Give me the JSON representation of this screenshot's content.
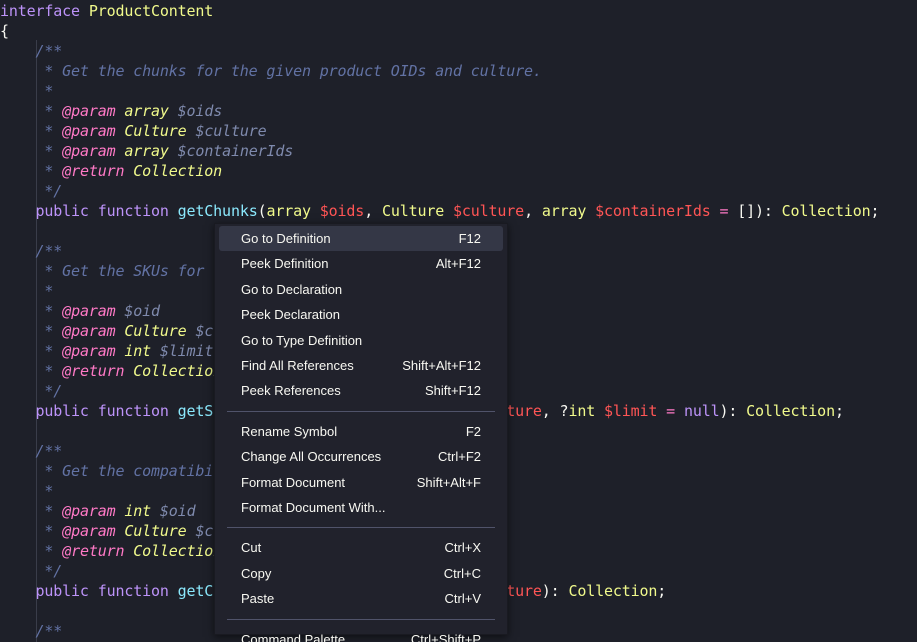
{
  "code": {
    "lines": [
      [
        [
          "kw2",
          "interface"
        ],
        [
          "plain",
          " "
        ],
        [
          "type",
          "ProductContent"
        ]
      ],
      [
        [
          "plain",
          "{"
        ]
      ],
      [
        [
          "plain",
          "    "
        ],
        [
          "comment",
          "/**"
        ]
      ],
      [
        [
          "plain",
          "    "
        ],
        [
          "comment",
          " * Get the chunks for the given product OIDs and culture."
        ]
      ],
      [
        [
          "plain",
          "    "
        ],
        [
          "comment",
          " *"
        ]
      ],
      [
        [
          "plain",
          "    "
        ],
        [
          "comment",
          " * "
        ],
        [
          "tag",
          "@param"
        ],
        [
          "comment",
          " "
        ],
        [
          "ctype",
          "array"
        ],
        [
          "comment",
          " "
        ],
        [
          "cvar",
          "$oids"
        ]
      ],
      [
        [
          "plain",
          "    "
        ],
        [
          "comment",
          " * "
        ],
        [
          "tag",
          "@param"
        ],
        [
          "comment",
          " "
        ],
        [
          "ctype",
          "Culture"
        ],
        [
          "comment",
          " "
        ],
        [
          "cvar",
          "$culture"
        ]
      ],
      [
        [
          "plain",
          "    "
        ],
        [
          "comment",
          " * "
        ],
        [
          "tag",
          "@param"
        ],
        [
          "comment",
          " "
        ],
        [
          "ctype",
          "array"
        ],
        [
          "comment",
          " "
        ],
        [
          "cvar",
          "$containerIds"
        ]
      ],
      [
        [
          "plain",
          "    "
        ],
        [
          "comment",
          " * "
        ],
        [
          "tag",
          "@return"
        ],
        [
          "comment",
          " "
        ],
        [
          "ctype",
          "Collection"
        ]
      ],
      [
        [
          "plain",
          "    "
        ],
        [
          "comment",
          " */"
        ]
      ],
      [
        [
          "plain",
          "    "
        ],
        [
          "kw2",
          "public"
        ],
        [
          "plain",
          " "
        ],
        [
          "kw2",
          "function"
        ],
        [
          "plain",
          " "
        ],
        [
          "fn2",
          "getChunks"
        ],
        [
          "punc",
          "("
        ],
        [
          "type",
          "array"
        ],
        [
          "plain",
          " "
        ],
        [
          "var2",
          "$oids"
        ],
        [
          "punc",
          ", "
        ],
        [
          "type",
          "Culture"
        ],
        [
          "plain",
          " "
        ],
        [
          "var2",
          "$culture"
        ],
        [
          "punc",
          ", "
        ],
        [
          "type",
          "array"
        ],
        [
          "plain",
          " "
        ],
        [
          "var2",
          "$containerIds"
        ],
        [
          "plain",
          " "
        ],
        [
          "op",
          "="
        ],
        [
          "plain",
          " "
        ],
        [
          "punc",
          "[]): "
        ],
        [
          "type",
          "Collection"
        ],
        [
          "punc",
          ";"
        ]
      ],
      [],
      [
        [
          "plain",
          "    "
        ],
        [
          "comment",
          "/**"
        ]
      ],
      [
        [
          "plain",
          "    "
        ],
        [
          "comment",
          " * Get the SKUs for"
        ]
      ],
      [
        [
          "plain",
          "    "
        ],
        [
          "comment",
          " *"
        ]
      ],
      [
        [
          "plain",
          "    "
        ],
        [
          "comment",
          " * "
        ],
        [
          "tag",
          "@param"
        ],
        [
          "comment",
          " "
        ],
        [
          "cvar",
          "$oid"
        ]
      ],
      [
        [
          "plain",
          "    "
        ],
        [
          "comment",
          " * "
        ],
        [
          "tag",
          "@param"
        ],
        [
          "comment",
          " "
        ],
        [
          "ctype",
          "Culture"
        ],
        [
          "comment",
          " "
        ],
        [
          "cvar",
          "$c"
        ]
      ],
      [
        [
          "plain",
          "    "
        ],
        [
          "comment",
          " * "
        ],
        [
          "tag",
          "@param"
        ],
        [
          "comment",
          " "
        ],
        [
          "ctype",
          "int"
        ],
        [
          "comment",
          " "
        ],
        [
          "cvar",
          "$limit"
        ]
      ],
      [
        [
          "plain",
          "    "
        ],
        [
          "comment",
          " * "
        ],
        [
          "tag",
          "@return"
        ],
        [
          "comment",
          " "
        ],
        [
          "ctype",
          "Collection"
        ]
      ],
      [
        [
          "plain",
          "    "
        ],
        [
          "comment",
          " */"
        ]
      ],
      [
        [
          "plain",
          "    "
        ],
        [
          "kw2",
          "public"
        ],
        [
          "plain",
          " "
        ],
        [
          "kw2",
          "function"
        ],
        [
          "plain",
          " "
        ],
        [
          "fn2",
          "getS"
        ],
        [
          "plain",
          "                             "
        ],
        [
          "var2",
          "$culture"
        ],
        [
          "punc",
          ", ?"
        ],
        [
          "type",
          "int"
        ],
        [
          "plain",
          " "
        ],
        [
          "var2",
          "$limit"
        ],
        [
          "plain",
          " "
        ],
        [
          "op",
          "="
        ],
        [
          "plain",
          " "
        ],
        [
          "kw2",
          "null"
        ],
        [
          "punc",
          "): "
        ],
        [
          "type",
          "Collection"
        ],
        [
          "punc",
          ";"
        ]
      ],
      [],
      [
        [
          "plain",
          "    "
        ],
        [
          "comment",
          "/**"
        ]
      ],
      [
        [
          "plain",
          "    "
        ],
        [
          "comment",
          " * Get the compatibi"
        ]
      ],
      [
        [
          "plain",
          "    "
        ],
        [
          "comment",
          " *"
        ]
      ],
      [
        [
          "plain",
          "    "
        ],
        [
          "comment",
          " * "
        ],
        [
          "tag",
          "@param"
        ],
        [
          "comment",
          " "
        ],
        [
          "ctype",
          "int"
        ],
        [
          "comment",
          " "
        ],
        [
          "cvar",
          "$oid"
        ]
      ],
      [
        [
          "plain",
          "    "
        ],
        [
          "comment",
          " * "
        ],
        [
          "tag",
          "@param"
        ],
        [
          "comment",
          " "
        ],
        [
          "ctype",
          "Culture"
        ],
        [
          "comment",
          " "
        ],
        [
          "cvar",
          "$c"
        ]
      ],
      [
        [
          "plain",
          "    "
        ],
        [
          "comment",
          " * "
        ],
        [
          "tag",
          "@return"
        ],
        [
          "comment",
          " "
        ],
        [
          "ctype",
          "Collection"
        ]
      ],
      [
        [
          "plain",
          "    "
        ],
        [
          "comment",
          " */"
        ]
      ],
      [
        [
          "plain",
          "    "
        ],
        [
          "kw2",
          "public"
        ],
        [
          "plain",
          " "
        ],
        [
          "kw2",
          "function"
        ],
        [
          "plain",
          " "
        ],
        [
          "fn2",
          "getC"
        ],
        [
          "plain",
          "                             "
        ],
        [
          "var2",
          "$culture"
        ],
        [
          "punc",
          "): "
        ],
        [
          "type",
          "Collection"
        ],
        [
          "punc",
          ";"
        ]
      ],
      [],
      [
        [
          "plain",
          "    "
        ],
        [
          "comment",
          "/**"
        ]
      ]
    ]
  },
  "context_menu": {
    "groups": [
      [
        {
          "label": "Go to Definition",
          "shortcut": "F12",
          "active": true
        },
        {
          "label": "Peek Definition",
          "shortcut": "Alt+F12"
        },
        {
          "label": "Go to Declaration",
          "shortcut": ""
        },
        {
          "label": "Peek Declaration",
          "shortcut": ""
        },
        {
          "label": "Go to Type Definition",
          "shortcut": ""
        },
        {
          "label": "Find All References",
          "shortcut": "Shift+Alt+F12"
        },
        {
          "label": "Peek References",
          "shortcut": "Shift+F12"
        }
      ],
      [
        {
          "label": "Rename Symbol",
          "shortcut": "F2"
        },
        {
          "label": "Change All Occurrences",
          "shortcut": "Ctrl+F2"
        },
        {
          "label": "Format Document",
          "shortcut": "Shift+Alt+F"
        },
        {
          "label": "Format Document With...",
          "shortcut": ""
        }
      ],
      [
        {
          "label": "Cut",
          "shortcut": "Ctrl+X"
        },
        {
          "label": "Copy",
          "shortcut": "Ctrl+C"
        },
        {
          "label": "Paste",
          "shortcut": "Ctrl+V"
        }
      ],
      [
        {
          "label": "Command Palette...",
          "shortcut": "Ctrl+Shift+P"
        }
      ]
    ]
  },
  "colors": {
    "editor_background": "#1e2029",
    "menu_background": "#21222c",
    "menu_active": "#343746",
    "keyword": "#bd93f9",
    "function": "#8be9fd",
    "type": "#f1fa8c",
    "variable": "#ff5555",
    "comment": "#6272a4",
    "doc_tag": "#ff79c6"
  }
}
